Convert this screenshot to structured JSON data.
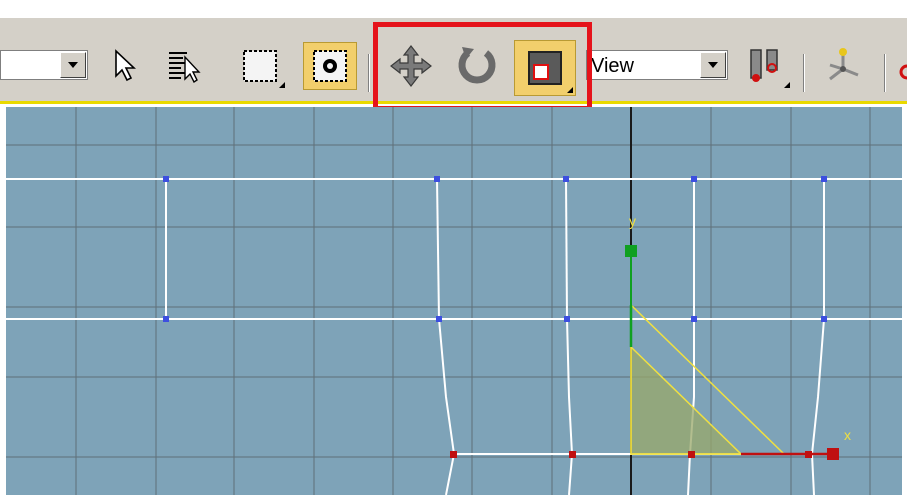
{
  "toolbar": {
    "selection_filter": "",
    "reference_coord_system": "View",
    "tools": {
      "select": "select-object-tool",
      "select_by_name": "select-by-name-tool",
      "rect_region": "rectangular-selection-region-tool",
      "window_crossing": "window-crossing-toggle",
      "move": "select-and-move-tool",
      "rotate": "select-and-rotate-tool",
      "scale": "select-and-uniform-scale-tool",
      "pivot": "use-pivot-point-center",
      "manipulate": "select-and-manipulate-tool"
    },
    "active_tools": [
      "window_crossing",
      "scale"
    ],
    "highlight_color": "#e5131b"
  },
  "viewport": {
    "background": "#7ea3b8",
    "grid_color": "#5f6f78",
    "spline_color": "#ffffff",
    "vertex_color": "#3d4fe0",
    "gizmo_color": "#f0e040",
    "axis_labels": {
      "x": "x",
      "y": "y"
    },
    "axis_colors": {
      "x": "#c01010",
      "y": "#10a020"
    }
  }
}
